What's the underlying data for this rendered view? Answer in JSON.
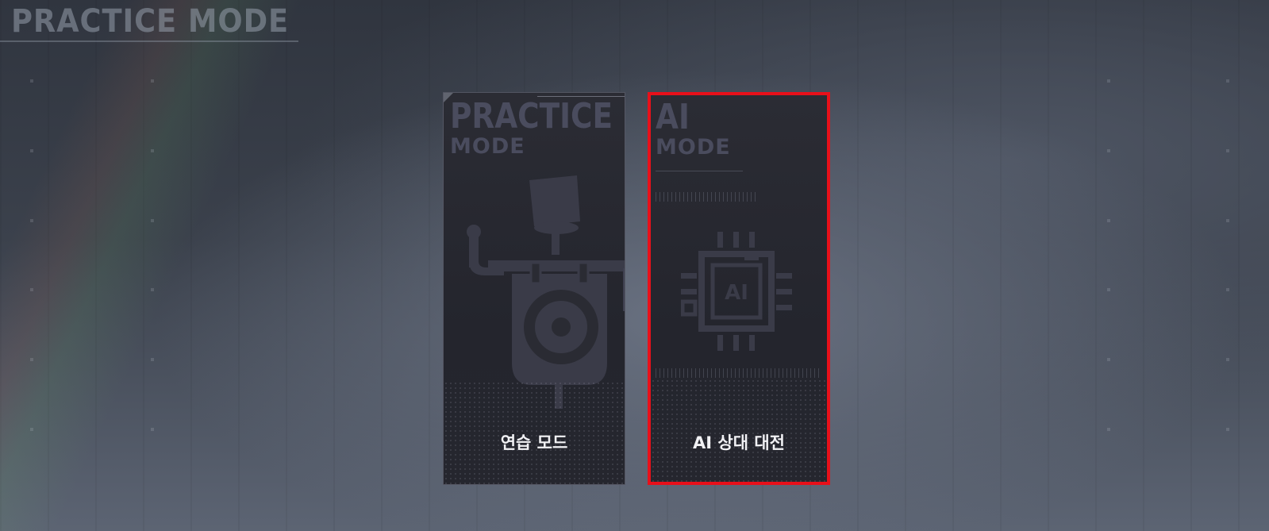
{
  "page": {
    "title": "PRACTICE MODE"
  },
  "cards": [
    {
      "id": "practice",
      "big_title_line1": "PRACTICE",
      "big_title_line2": "MODE",
      "label": "연습 모드",
      "icon": "training-dummy-icon",
      "selected": false
    },
    {
      "id": "ai",
      "big_title_line1": "AI",
      "big_title_line2": "MODE",
      "label": "AI 상대 대전",
      "icon": "ai-chip-icon",
      "chip_text": "AI",
      "selected": true
    }
  ],
  "colors": {
    "selection_border": "#e8101a",
    "card_bg": "#25262e",
    "card_title": "#4a4c5e",
    "label_text": "#f1f1f4"
  }
}
